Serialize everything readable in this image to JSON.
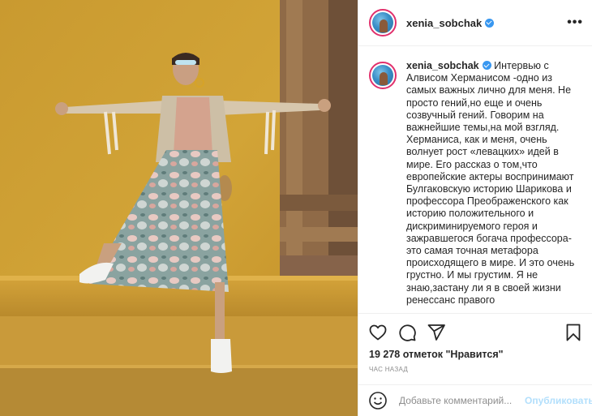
{
  "post": {
    "username": "xenia_sobchak",
    "verified": true,
    "more_icon": "three-dots-icon",
    "caption": "Интервью с Алвисом Херманисом -одно из самых важных лично для меня. Не просто гений,но еще и очень созвучный гений. Говорим на важнейшие темы,на мой взгляд. Херманиса, как и меня, очень волнует рост «левацких» идей в мире. Его рассказ о том,что европейские актеры воспринимают Булгаковскую историю Шарикова и профессора Преображенского как историю положительного и дискриминируемого героя и зажравшегося богача профессора- это самая точная метафора происходящего в мире. И это очень грустно. И мы грустим. Я не знаю,застану ли я в своей жизни ренессанс правого",
    "likes": "19 278 отметок \"Нравится\"",
    "time": "ЧАС НАЗАД"
  },
  "actions": {
    "like_icon": "heart-icon",
    "comment_icon": "comment-bubble-icon",
    "share_icon": "paper-plane-icon",
    "save_icon": "bookmark-icon"
  },
  "comment_box": {
    "placeholder": "Добавьте комментарий...",
    "value": "",
    "publish_label": "Опубликовать",
    "emoji_icon": "smiley-icon"
  },
  "colors": {
    "verified": "#3897f0",
    "publish_disabled": "#b2dffc",
    "wall": "#c9962a",
    "story_ring": "#e1306c"
  }
}
